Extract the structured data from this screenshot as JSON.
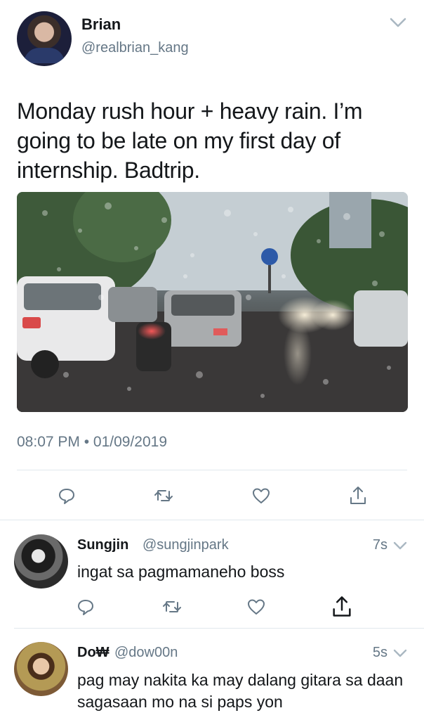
{
  "tweet": {
    "author_name": "Brian",
    "author_handle": "@realbrian_kang",
    "text": "Monday rush hour + heavy rain. I’m going to be late on my first day of internship. Badtrip.",
    "timestamp": "08:07 PM • 01/09/2019",
    "actions": [
      "reply-icon",
      "retweet-icon",
      "like-icon",
      "share-icon"
    ]
  },
  "replies": [
    {
      "name": "Sungjin",
      "handle": "@sungjinpark",
      "time": "7s",
      "text": "ingat sa pagmamaneho boss"
    },
    {
      "name": "Do₩",
      "handle": "@dow00n",
      "time": "5s",
      "text": "pag may nakita ka may dalang gitara sa daan sagasaan mo na si paps yon"
    }
  ],
  "colors": {
    "text": "#14171a",
    "secondary": "#657786",
    "divider": "#e1e8ed"
  }
}
